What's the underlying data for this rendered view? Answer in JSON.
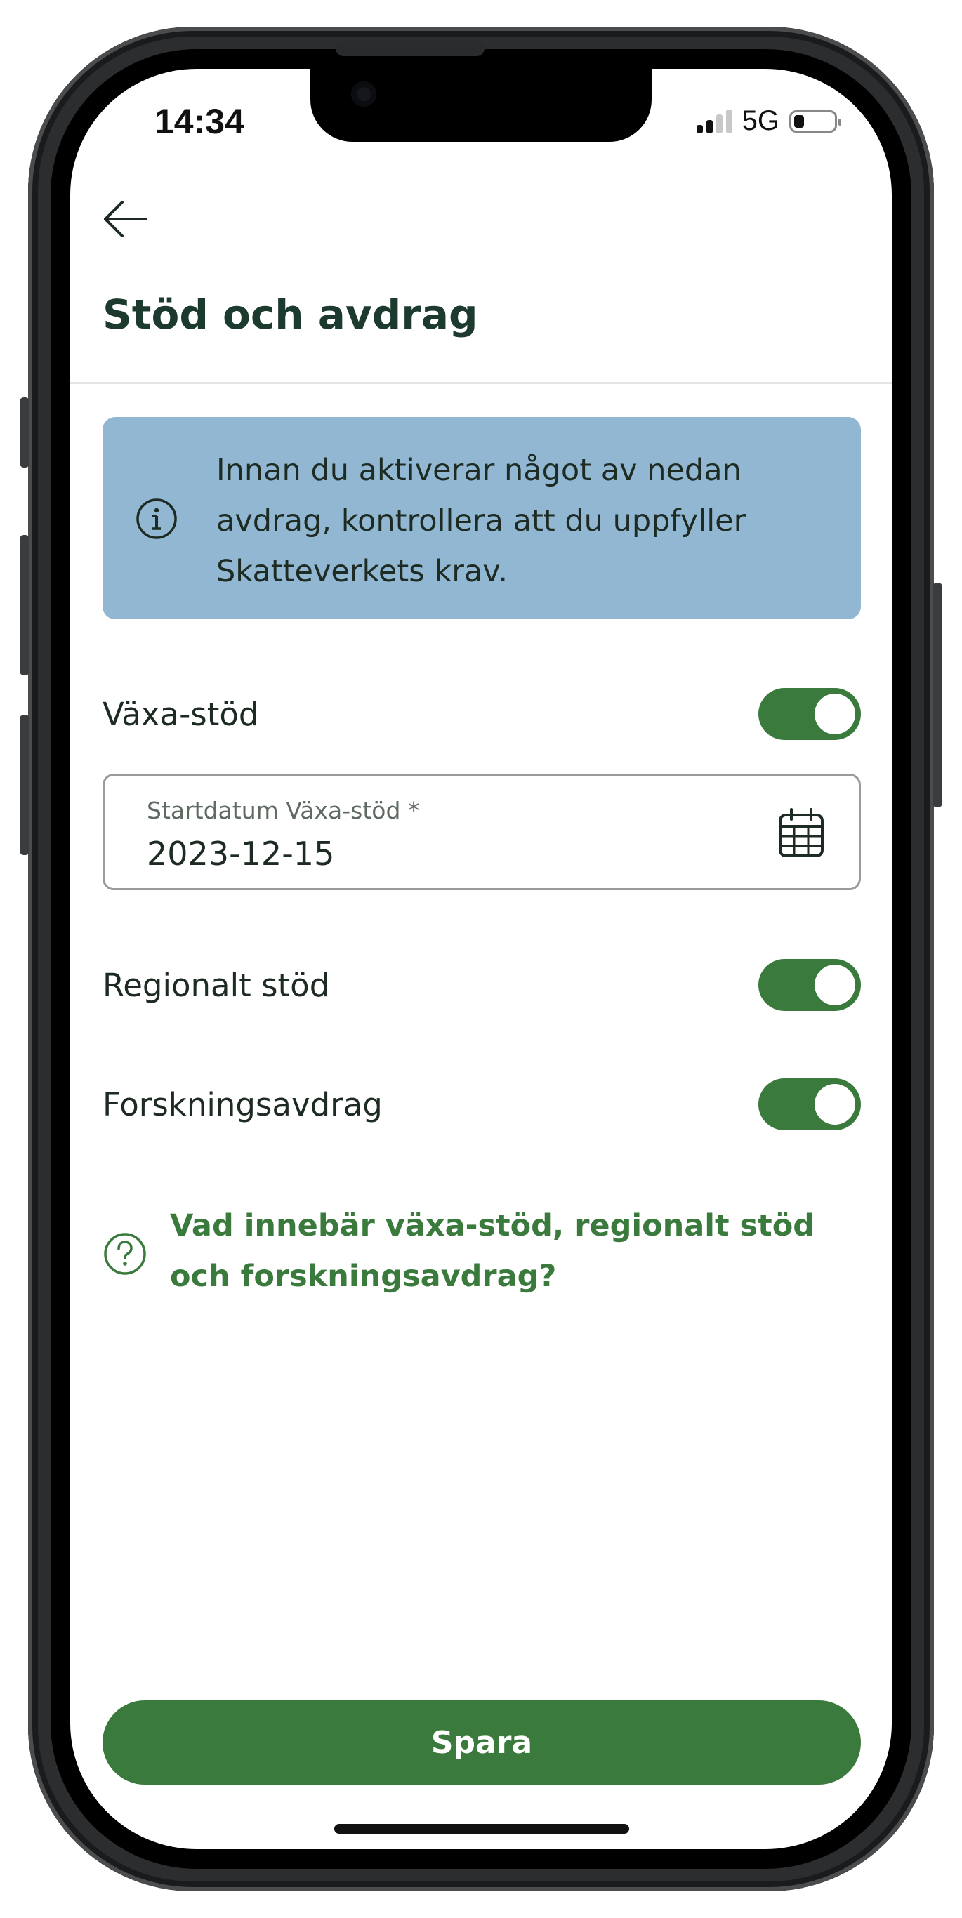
{
  "status_bar": {
    "time": "14:34",
    "network": "5G"
  },
  "header": {
    "back_icon": "arrow-left-icon",
    "title": "Stöd och avdrag"
  },
  "info_banner": {
    "icon": "info-circle-icon",
    "text": "Innan du aktiverar något av nedan avdrag, kontrollera att du uppfyller Skatteverkets krav."
  },
  "settings": {
    "vaxa_stod": {
      "label": "Växa-stöd",
      "enabled": true
    },
    "start_date": {
      "label": "Startdatum Växa-stöd *",
      "value": "2023-12-15",
      "icon": "calendar-icon"
    },
    "regionalt_stod": {
      "label": "Regionalt stöd",
      "enabled": true
    },
    "forskningsavdrag": {
      "label": "Forskningsavdrag",
      "enabled": true
    }
  },
  "help_link": {
    "icon": "question-circle-icon",
    "text": "Vad innebär växa-stöd, regionalt stöd och forskningsavdrag?"
  },
  "actions": {
    "save_label": "Spara"
  },
  "colors": {
    "accent": "#3a7a3c",
    "title": "#1c3a2e",
    "info_background": "#92b7d3"
  }
}
